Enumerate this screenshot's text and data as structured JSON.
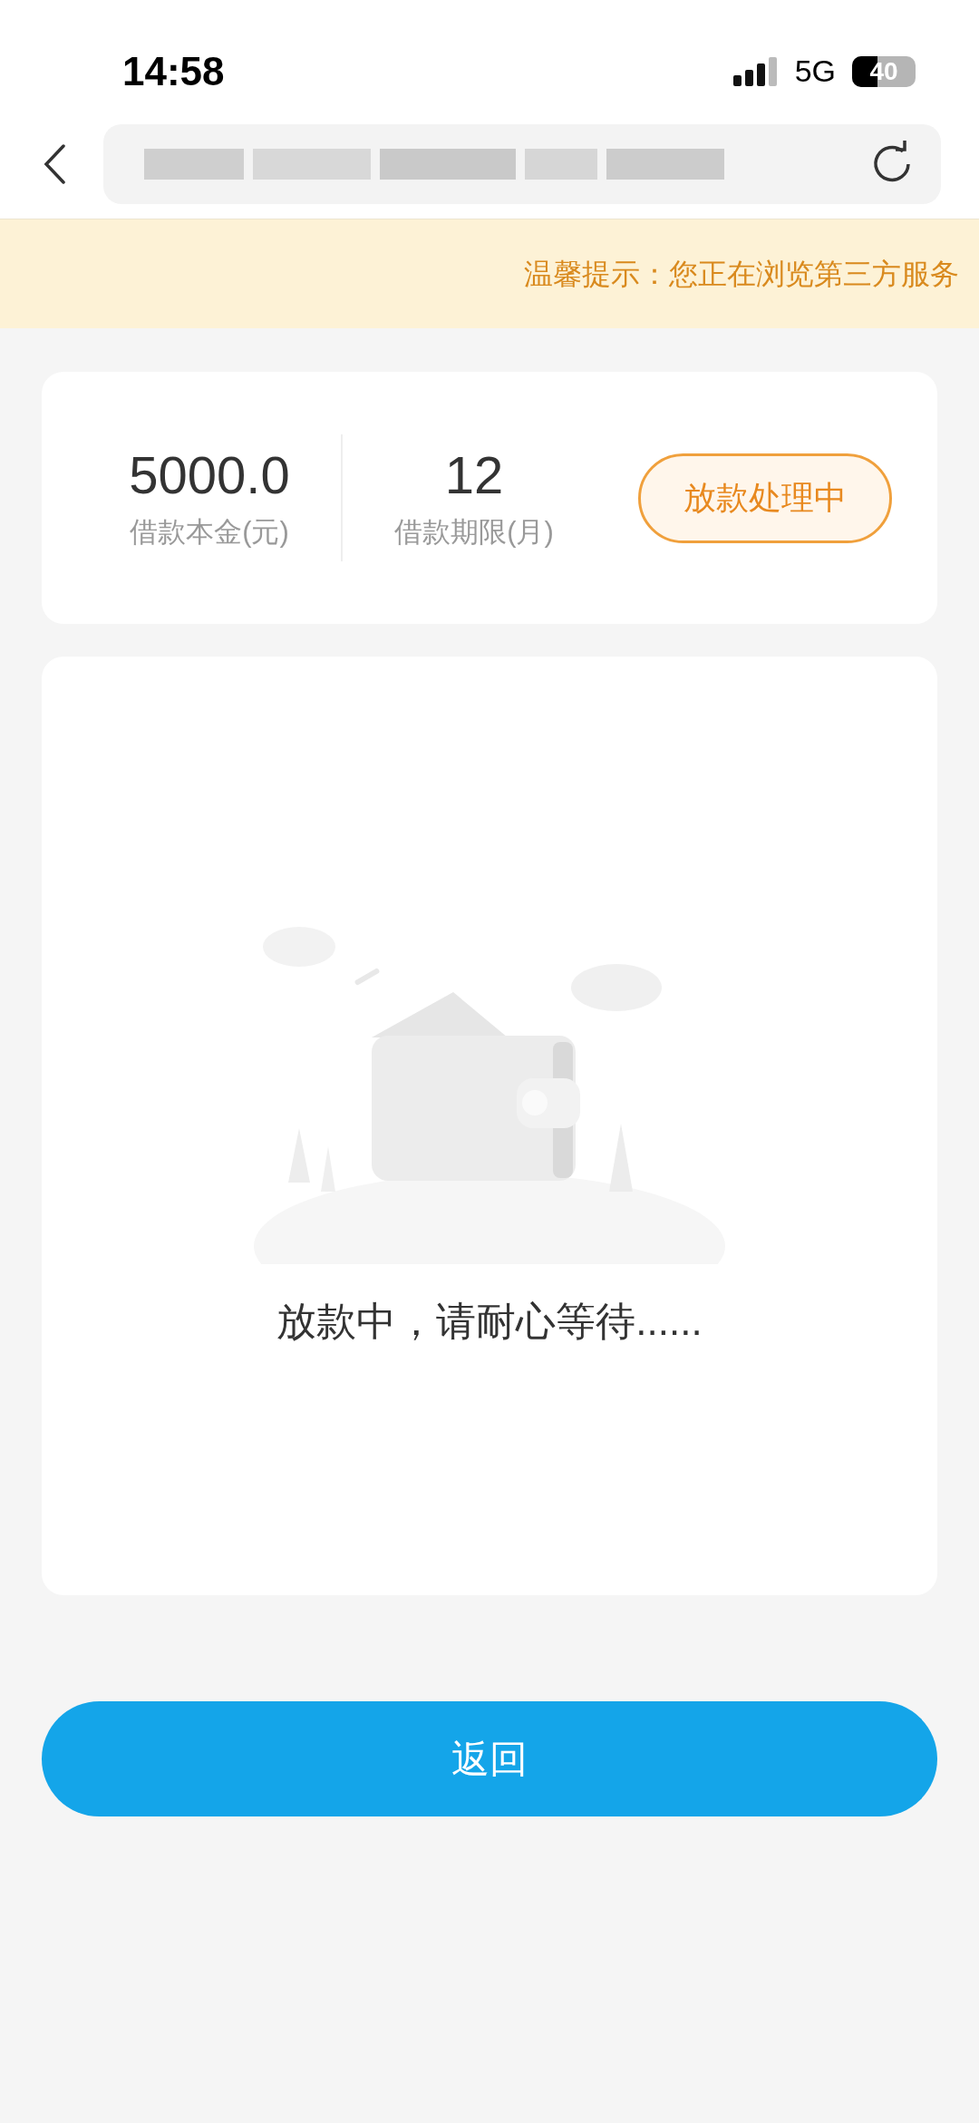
{
  "status_bar": {
    "time": "14:58",
    "network": "5G",
    "battery": "40"
  },
  "banner": {
    "text": "温馨提示：您正在浏览第三方服务"
  },
  "loan": {
    "items": [
      {
        "value": "5000.0",
        "label": "借款本金(元)"
      },
      {
        "value": "12",
        "label": "借款期限(月)"
      }
    ],
    "status": "放款处理中"
  },
  "message": "放款中，请耐心等待......",
  "back_button": "返回"
}
